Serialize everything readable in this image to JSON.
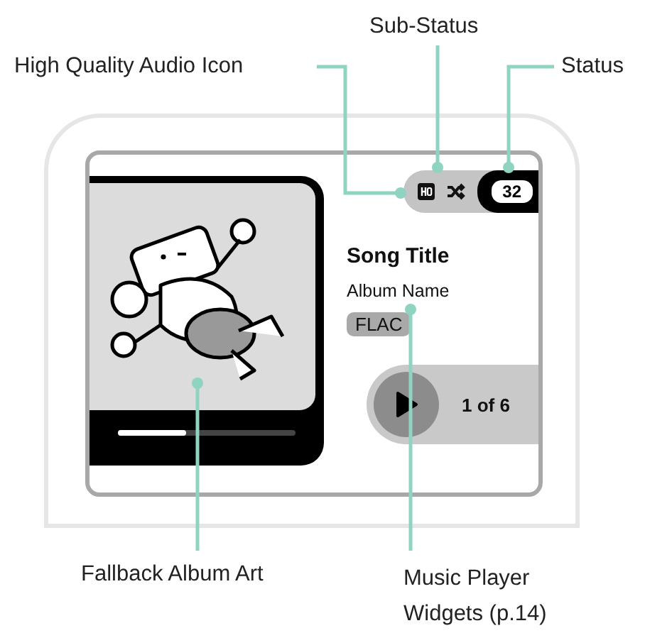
{
  "annotations": [
    {
      "label": "High Quality Audio Icon"
    },
    {
      "label": "Sub-Status"
    },
    {
      "label": "Status"
    },
    {
      "label": "Fallback Album Art"
    },
    {
      "label": "Music Player Widgets (p.14)"
    }
  ],
  "status": {
    "battery": "32"
  },
  "track": {
    "title": "Song Title",
    "album": "Album Name",
    "format": "FLAC"
  },
  "progress": {
    "level": 0.38
  },
  "player": {
    "position": "1 of 6"
  }
}
